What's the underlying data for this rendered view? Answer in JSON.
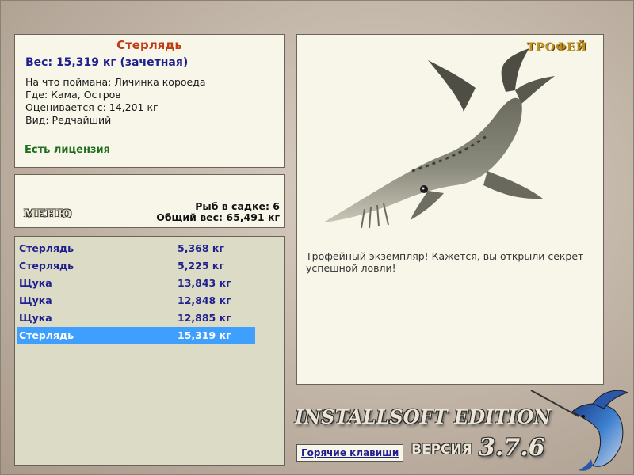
{
  "catch": {
    "name": "Стерлядь",
    "weight": "Вес: 15,319 кг (зачетная)",
    "bait": "На что поймана: Личинка короеда",
    "location": "Где: Кама, Остров",
    "valued_from": "Оценивается с: 14,201 кг",
    "rarity": "Вид: Редчайший",
    "license": "Есть лицензия"
  },
  "cage": {
    "menu_label": "МЕНЮ",
    "count": "Рыб в садке: 6",
    "total": "Общий вес: 65,491 кг"
  },
  "fish_list": [
    {
      "name": "Стерлядь",
      "weight": "5,368 кг"
    },
    {
      "name": "Стерлядь",
      "weight": "5,225 кг"
    },
    {
      "name": "Щука",
      "weight": "13,843 кг"
    },
    {
      "name": "Щука",
      "weight": "12,848 кг"
    },
    {
      "name": "Щука",
      "weight": "12,885 кг"
    },
    {
      "name": "Стерлядь",
      "weight": "15,319 кг"
    }
  ],
  "trophy": {
    "label": "ТРОФЕЙ",
    "description": "Трофейный экземпляр! Кажется, вы открыли секрет успешной ловли!"
  },
  "footer": {
    "brand": "INSTALLSOFT EDITION",
    "hotkeys": "Горячие клавиши",
    "version_word": "ВЕРСИЯ",
    "version_number": "3.7.6"
  },
  "icons": {
    "trophy_image": "sterlet-fish-image",
    "logo": "marlin-icon"
  },
  "colors": {
    "title": "#c03a12",
    "weight": "#1f1f8f",
    "license": "#1e6e1e",
    "selection": "#3f9fff"
  }
}
